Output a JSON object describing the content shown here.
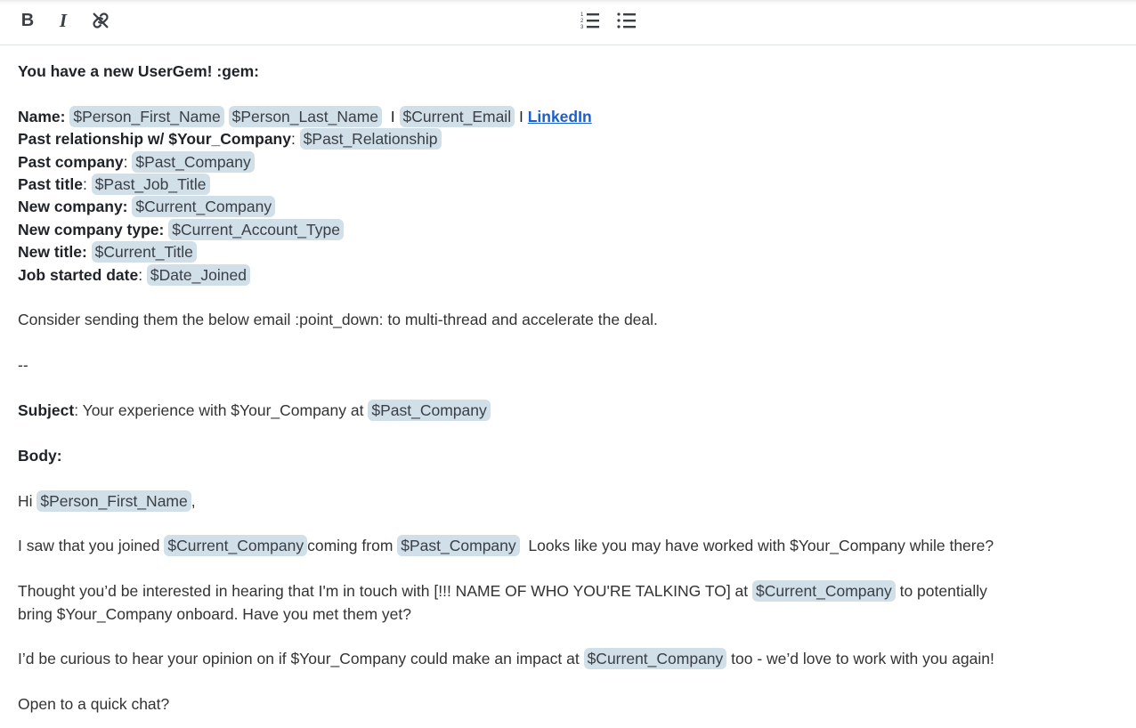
{
  "toolbar": {
    "bold_label": "B",
    "italic_label": "I"
  },
  "message": {
    "title": "You have a new UserGem! :gem:",
    "name_label": "Name:",
    "first_name": "$Person_First_Name",
    "last_name": "$Person_Last_Name",
    "sep": "I",
    "email": "$Current_Email",
    "linkedin": "LinkedIn",
    "past_rel_label": "Past relationship w/ $Your_Company",
    "past_relationship": "$Past_Relationship",
    "past_company_label": "Past company",
    "past_company": "$Past_Company",
    "past_title_label": "Past title",
    "past_job_title": "$Past_Job_Title",
    "new_company_label": "New company:",
    "current_company": "$Current_Company",
    "new_company_type_label": "New company type:",
    "current_account_type": "$Current_Account_Type",
    "new_title_label": "New title:",
    "current_title": "$Current_Title",
    "job_started_label": "Job started date",
    "date_joined": "$Date_Joined",
    "consider": "Consider sending them the below email :point_down: to multi-thread and accelerate the deal.",
    "dashes": "--",
    "subject_label": "Subject",
    "subject_text": ": Your experience with $Your_Company at ",
    "body_label": "Body:",
    "hi": "Hi ",
    "comma": ",",
    "saw_1": "I saw that you joined ",
    "saw_2": "coming from ",
    "saw_3": "  Looks like you may have worked with $Your_Company while there?",
    "thought_1": "Thought you’d be interested in hearing that I'm in touch with [!!! NAME OF WHO YOU'RE TALKING TO] at ",
    "thought_2": " to potentially bring $Your_Company onboard. Have you met them yet?",
    "curious_1": "I’d be curious to hear your opinion on if $Your_Company could make an impact at ",
    "curious_2": " too - we’d love to work with you again!",
    "open": "Open to a quick chat?",
    "colon": ": "
  }
}
